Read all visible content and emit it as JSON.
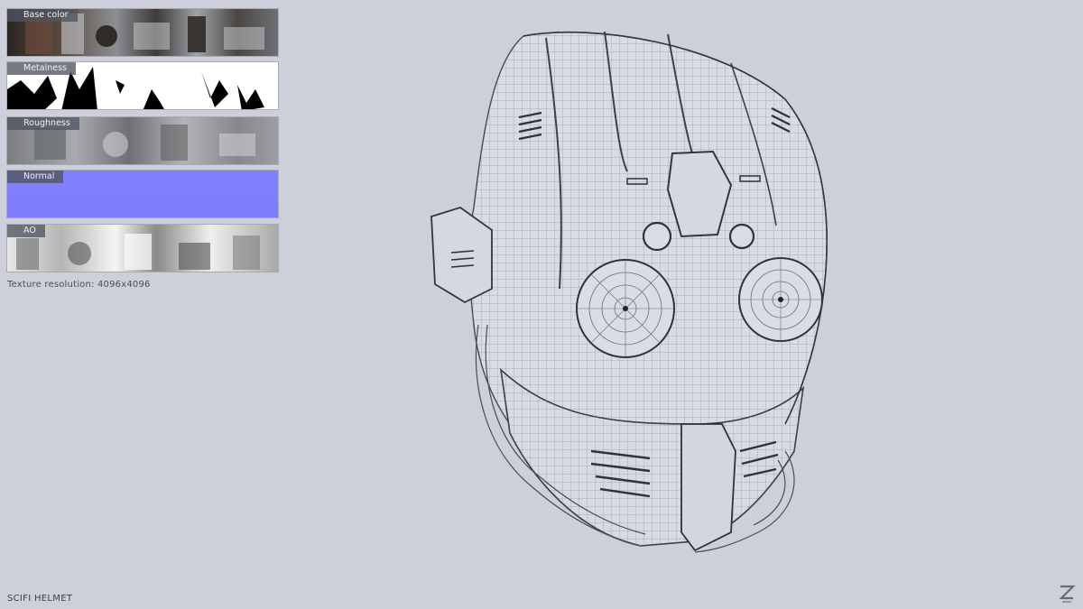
{
  "texture_panels": [
    {
      "label": "Base color"
    },
    {
      "label": "Metalness"
    },
    {
      "label": "Roughness"
    },
    {
      "label": "Normal"
    },
    {
      "label": "AO"
    }
  ],
  "texture_resolution_text": "Texture resolution: 4096x4096",
  "model_title": "SCIFI HELMET",
  "logo_icon": "z-logo-icon",
  "colors": {
    "background": "#cdd0db",
    "normal_map": "#8080ff",
    "wire": "#4a4d55"
  }
}
